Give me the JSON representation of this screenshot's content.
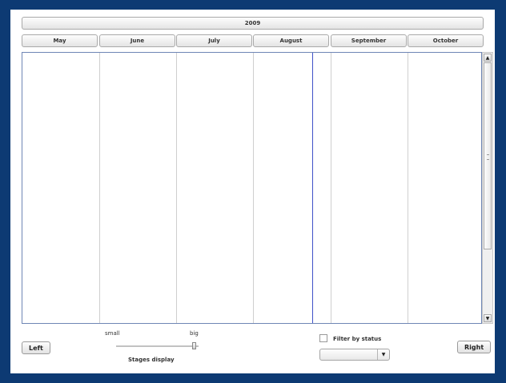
{
  "timeline": {
    "year": "2009",
    "months": [
      "May",
      "June",
      "July",
      "August",
      "September",
      "October"
    ]
  },
  "scrollbar": {
    "up_glyph": "▲",
    "down_glyph": "▼"
  },
  "controls": {
    "left_label": "Left",
    "right_label": "Right",
    "slider": {
      "min_label": "small",
      "max_label": "big",
      "caption": "Stages display",
      "value_fraction": 1.0
    },
    "filter": {
      "label": "Filter by status",
      "checked": false,
      "selected_value": "",
      "arrow_glyph": "▼"
    }
  }
}
